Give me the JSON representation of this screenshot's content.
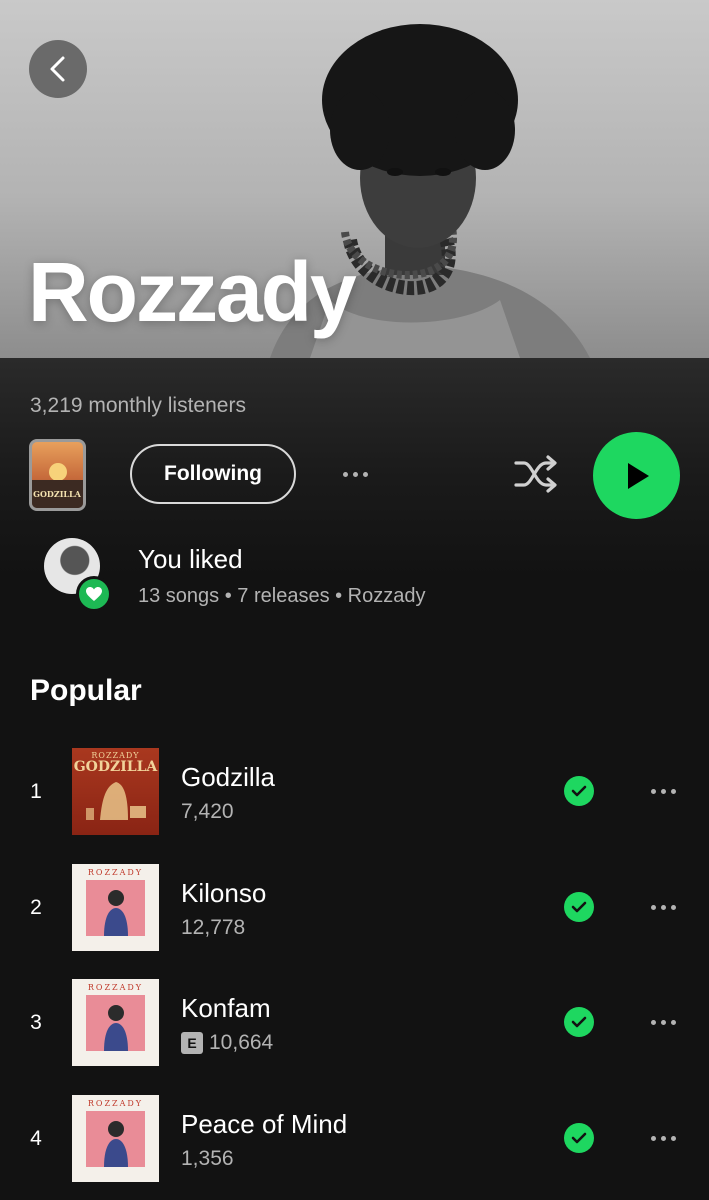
{
  "artist": {
    "name": "Rozzady",
    "monthly_listeners": "3,219 monthly listeners"
  },
  "actions": {
    "follow_label": "Following",
    "cover_text": "GODZILLA"
  },
  "liked": {
    "title": "You liked",
    "subtitle": "13 songs • 7 releases • Rozzady"
  },
  "popular": {
    "title": "Popular",
    "tracks": [
      {
        "rank": "1",
        "title": "Godzilla",
        "plays": "7,420",
        "explicit": false,
        "art_top": "ROZZADY",
        "art_main": "GODZILLA"
      },
      {
        "rank": "2",
        "title": "Kilonso",
        "plays": "12,778",
        "explicit": false,
        "art_top": "ROZZADY"
      },
      {
        "rank": "3",
        "title": "Konfam",
        "plays": "10,664",
        "explicit": true,
        "explicit_label": "E",
        "art_top": "ROZZADY"
      },
      {
        "rank": "4",
        "title": "Peace of Mind",
        "plays": "1,356",
        "explicit": false,
        "art_top": "ROZZADY"
      }
    ]
  },
  "colors": {
    "accent": "#1ed760",
    "background": "#121212",
    "secondary_text": "#b3b3b3"
  },
  "icons": [
    "chevron-left-icon",
    "more-icon",
    "shuffle-icon",
    "play-icon",
    "heart-icon",
    "check-icon"
  ]
}
